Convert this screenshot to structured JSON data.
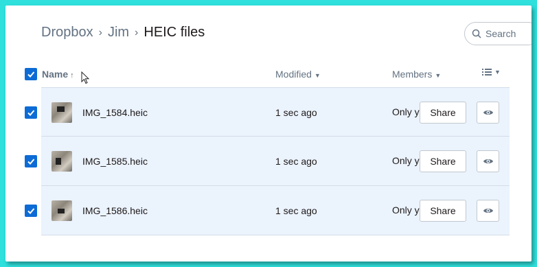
{
  "breadcrumb": {
    "items": [
      "Dropbox",
      "Jim"
    ],
    "current": "HEIC files"
  },
  "search": {
    "placeholder": "Search"
  },
  "columns": {
    "name": "Name",
    "name_sort_icon": "arrow-up-icon",
    "modified": "Modified",
    "members": "Members",
    "view_icon": "list-view-icon"
  },
  "rows": [
    {
      "name": "IMG_1584.heic",
      "modified": "1 sec ago",
      "members": "Only y",
      "share": "Share",
      "checked": true
    },
    {
      "name": "IMG_1585.heic",
      "modified": "1 sec ago",
      "members": "Only y",
      "share": "Share",
      "checked": true
    },
    {
      "name": "IMG_1586.heic",
      "modified": "1 sec ago",
      "members": "Only y",
      "share": "Share",
      "checked": true
    }
  ],
  "colors": {
    "accent": "#0d6bd5",
    "row_selected_bg": "#ebf3fd",
    "frame_border": "#2fe0dc"
  }
}
